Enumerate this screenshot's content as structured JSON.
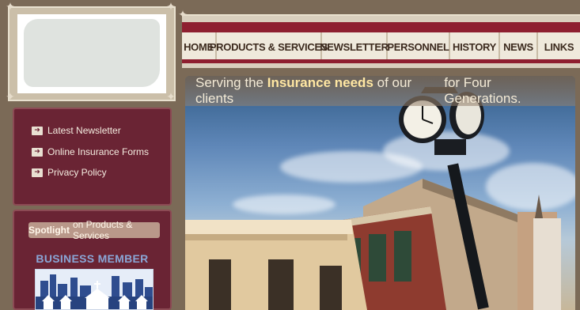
{
  "nav": {
    "items": [
      {
        "label": "HOME"
      },
      {
        "label": "PRODUCTS & SERVICES"
      },
      {
        "label": "NEWSLETTER"
      },
      {
        "label": "PERSONNEL"
      },
      {
        "label": "HISTORY"
      },
      {
        "label": "NEWS"
      },
      {
        "label": "LINKS"
      }
    ]
  },
  "hero": {
    "tagline_pre": "Serving the ",
    "tagline_highlight": "Insurance needs",
    "tagline_post": " of our clients",
    "tagline_right": "for Four Generations."
  },
  "sidebar": {
    "links": [
      {
        "label": "Latest Newsletter"
      },
      {
        "label": "Online Insurance Forms"
      },
      {
        "label": "Privacy Policy"
      }
    ],
    "spotlight": {
      "bold": "Spotlight",
      "rest": "on Products & Services"
    },
    "business_member_title": "BUSINESS MEMBER"
  },
  "colors": {
    "background": "#7b6a57",
    "accent_red": "#8e1f30",
    "panel": "#6a2434",
    "nav_bg": "#efe9dc"
  }
}
